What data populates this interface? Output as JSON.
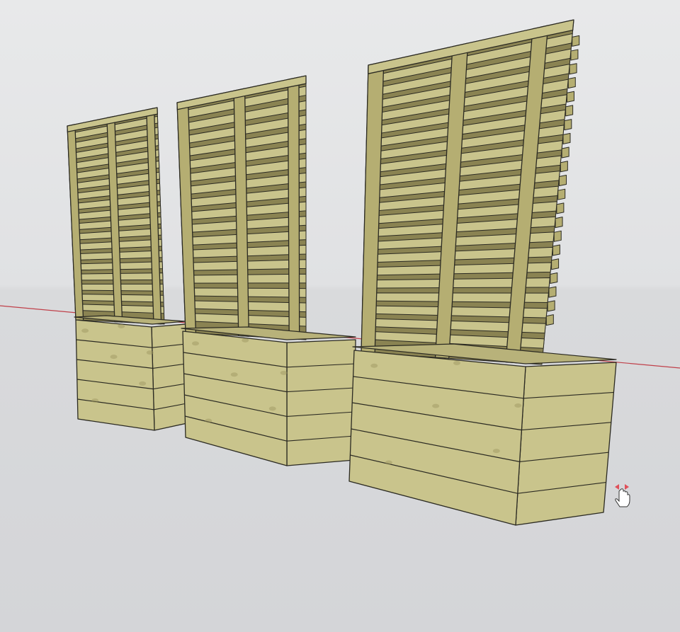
{
  "colors": {
    "sky_top": "#e6e7e8",
    "sky_bottom": "#dfe0e2",
    "ground": "#d6d7d9",
    "wood_light": "#c9c48c",
    "wood_mid": "#b5ae72",
    "wood_dark": "#9b945d",
    "edge": "#2b2a22",
    "axis_red": "#c0404a",
    "cursor_arrow": "#e0505a"
  },
  "planters": [
    {
      "name": "planter-left",
      "trellis_slats": 18
    },
    {
      "name": "planter-middle",
      "trellis_slats": 17
    },
    {
      "name": "planter-right",
      "trellis_slats": 21
    }
  ],
  "box_boards": 5,
  "cursor_icon": "pan-hand-icon"
}
